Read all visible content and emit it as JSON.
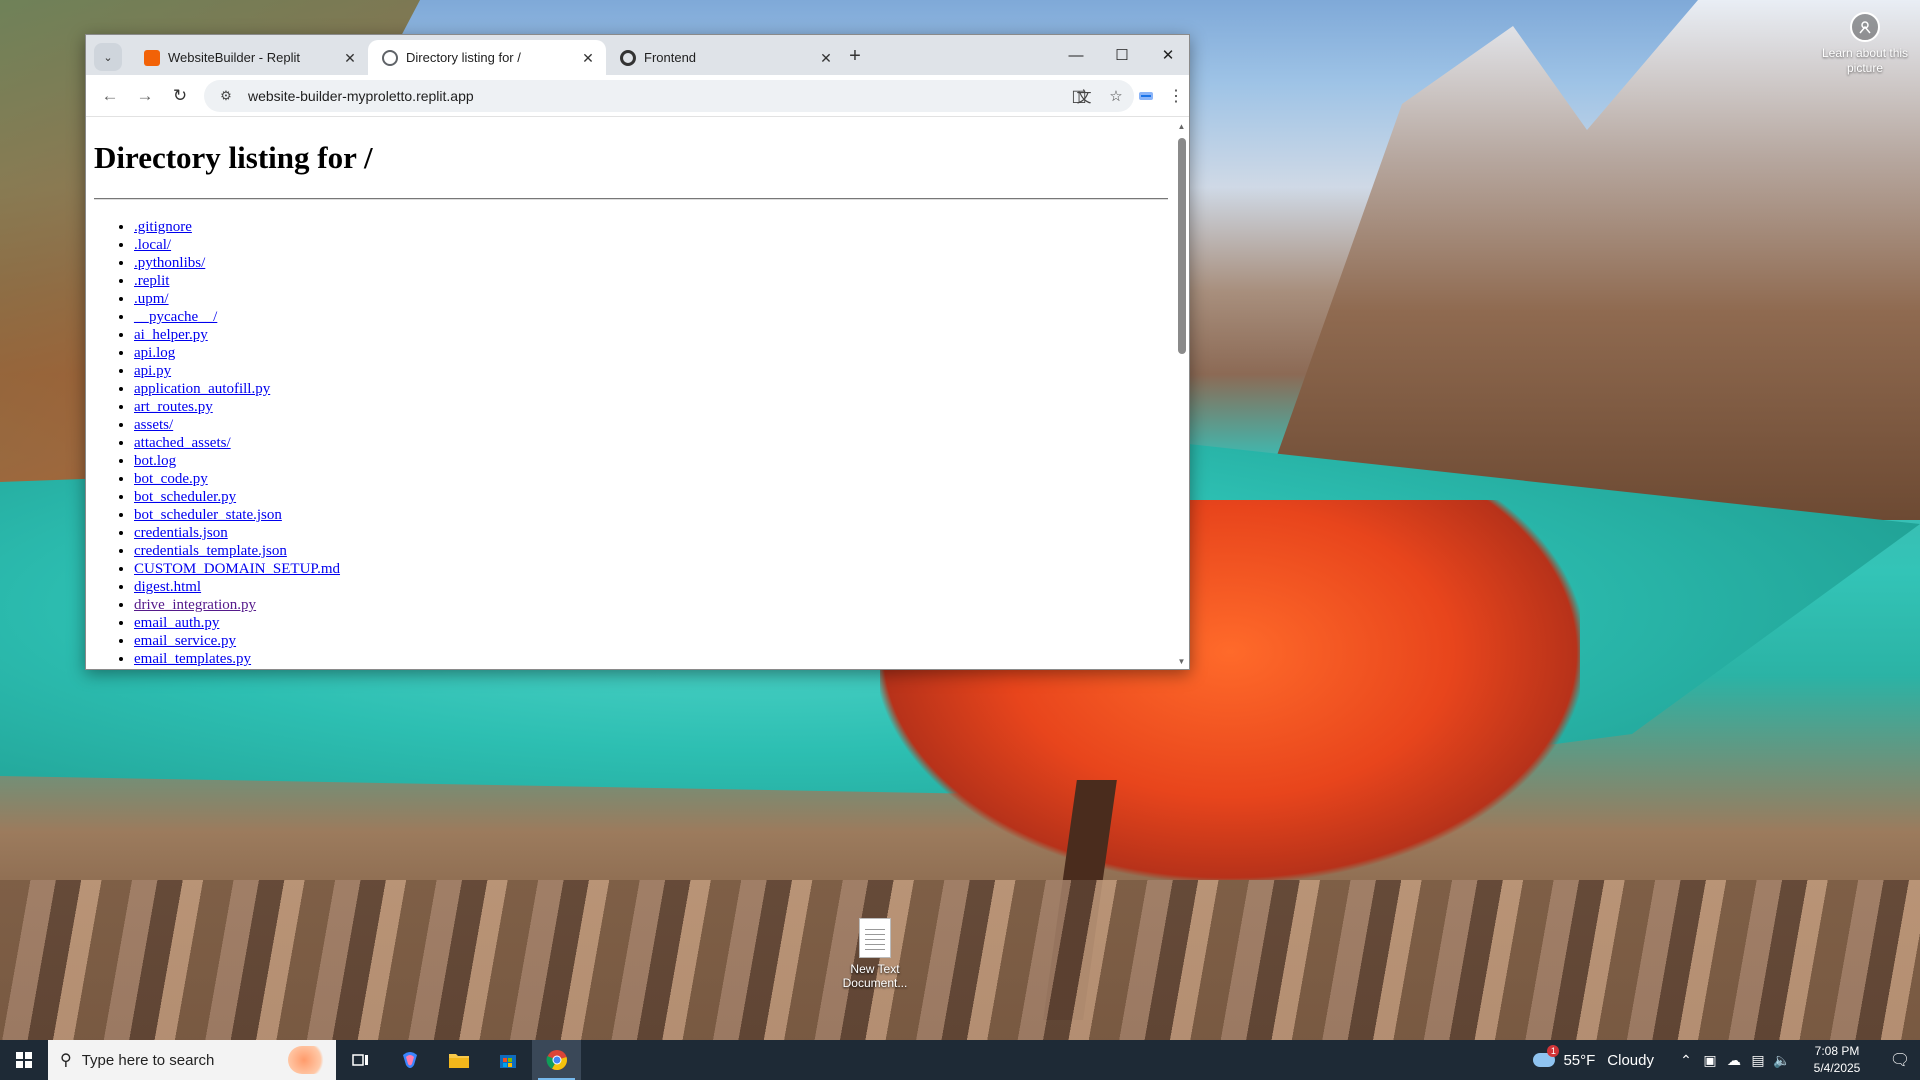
{
  "desktop": {
    "learn_picture_label": "Learn about this picture",
    "icons": [
      {
        "label": "New Text Document..."
      }
    ]
  },
  "browser": {
    "tabs": [
      {
        "title": "WebsiteBuilder - Replit",
        "favicon_color": "#f26207",
        "active": false
      },
      {
        "title": "Directory listing for /",
        "favicon_color": "#5f6368",
        "active": true
      },
      {
        "title": "Frontend",
        "favicon_color": "#333333",
        "active": false
      }
    ],
    "url": "website-builder-myproletto.replit.app"
  },
  "page": {
    "heading": "Directory listing for /",
    "files": [
      {
        "name": ".gitignore",
        "visited": false
      },
      {
        "name": ".local/",
        "visited": false
      },
      {
        "name": ".pythonlibs/",
        "visited": false
      },
      {
        "name": ".replit",
        "visited": false
      },
      {
        "name": ".upm/",
        "visited": false
      },
      {
        "name": "__pycache__/",
        "visited": false
      },
      {
        "name": "ai_helper.py",
        "visited": false
      },
      {
        "name": "api.log",
        "visited": false
      },
      {
        "name": "api.py",
        "visited": false
      },
      {
        "name": "application_autofill.py",
        "visited": false
      },
      {
        "name": "art_routes.py",
        "visited": false
      },
      {
        "name": "assets/",
        "visited": false
      },
      {
        "name": "attached_assets/",
        "visited": false
      },
      {
        "name": "bot.log",
        "visited": false
      },
      {
        "name": "bot_code.py",
        "visited": false
      },
      {
        "name": "bot_scheduler.py",
        "visited": false
      },
      {
        "name": "bot_scheduler_state.json",
        "visited": false
      },
      {
        "name": "credentials.json",
        "visited": false
      },
      {
        "name": "credentials_template.json",
        "visited": false
      },
      {
        "name": "CUSTOM_DOMAIN_SETUP.md",
        "visited": false
      },
      {
        "name": "digest.html",
        "visited": false
      },
      {
        "name": "drive_integration.py",
        "visited": true
      },
      {
        "name": "email_auth.py",
        "visited": false
      },
      {
        "name": "email_service.py",
        "visited": false
      },
      {
        "name": "email_templates.py",
        "visited": false
      }
    ]
  },
  "taskbar": {
    "search_placeholder": "Type here to search",
    "weather_temp": "55°F",
    "weather_desc": "Cloudy",
    "time": "7:08 PM",
    "date": "5/4/2025"
  }
}
